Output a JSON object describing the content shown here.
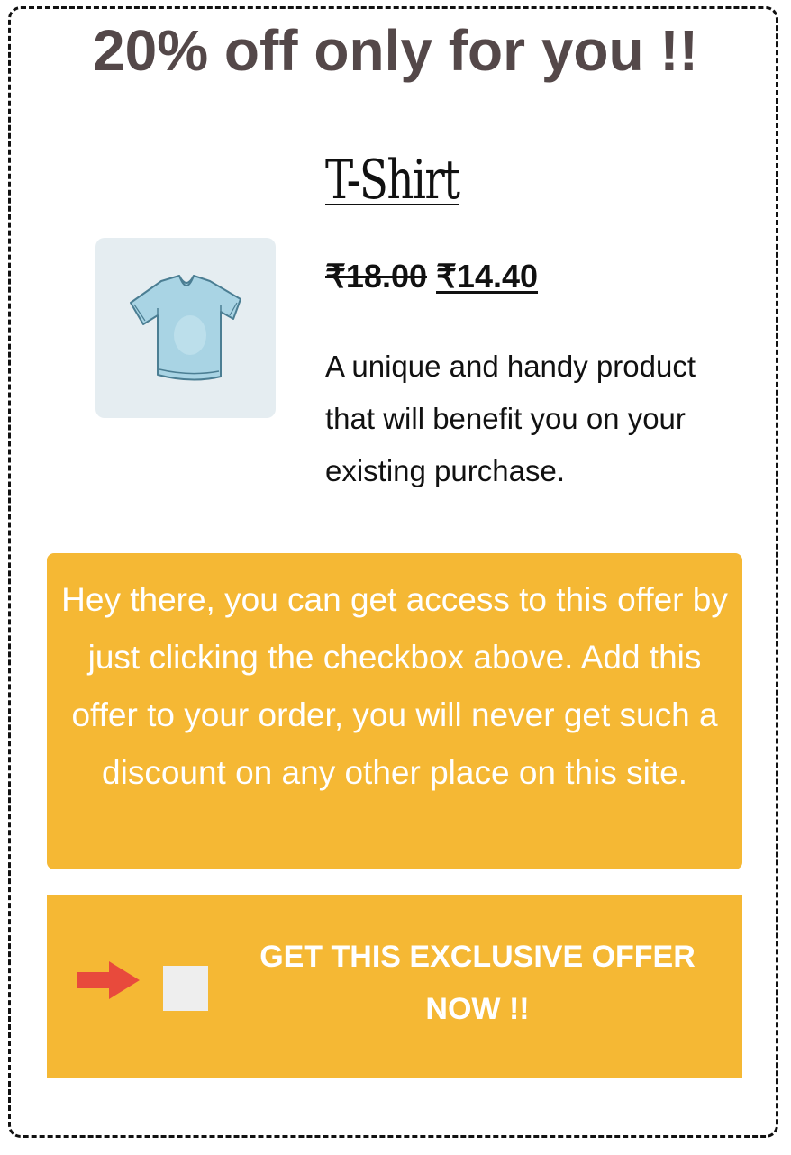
{
  "offer": {
    "headline": "20% off only for you !!"
  },
  "product": {
    "title": "T-Shirt",
    "image_icon": "tshirt-image",
    "price_original": "₹18.00",
    "price_discounted": "₹14.40",
    "description": "A unique and handy product that will benefit you on your existing purchase."
  },
  "promo": {
    "message": "Hey there, you can get access to this offer by just clicking the checkbox above. Add this offer to your order, you will never get such a discount on any other place on this site."
  },
  "cta": {
    "arrow_icon": "arrow-right-icon",
    "checkbox_checked": false,
    "label": "GET THIS EXCLUSIVE OFFER NOW !!"
  },
  "colors": {
    "accent": "#f5b834",
    "headline": "#544849",
    "arrow": "#e84a3c",
    "image_bg": "#e5edf1"
  }
}
